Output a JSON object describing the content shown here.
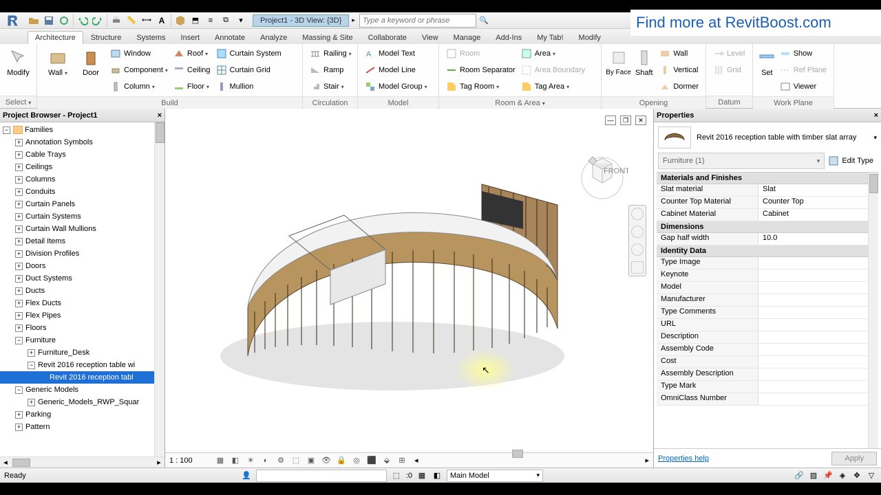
{
  "qat": {
    "title": "Project1 - 3D View: {3D}",
    "search_placeholder": "Type a keyword or phrase"
  },
  "boost_text": "Find more at RevitBoost.com",
  "tabs": [
    "Architecture",
    "Structure",
    "Systems",
    "Insert",
    "Annotate",
    "Analyze",
    "Massing & Site",
    "Collaborate",
    "View",
    "Manage",
    "Add-Ins",
    "My Tab!",
    "Modify"
  ],
  "active_tab": "Architecture",
  "ribbon": {
    "select": "Select",
    "modify": "Modify",
    "build": {
      "label": "Build",
      "wall": "Wall",
      "door": "Door",
      "window": "Window",
      "component": "Component",
      "column": "Column",
      "roof": "Roof",
      "ceiling": "Ceiling",
      "floor": "Floor",
      "curtain_system": "Curtain System",
      "curtain_grid": "Curtain Grid",
      "mullion": "Mullion"
    },
    "circulation": {
      "label": "Circulation",
      "railing": "Railing",
      "ramp": "Ramp",
      "stair": "Stair"
    },
    "model": {
      "label": "Model",
      "text": "Model Text",
      "line": "Model Line",
      "group": "Model Group"
    },
    "room_area": {
      "label": "Room & Area",
      "room": "Room",
      "sep": "Room Separator",
      "tag_room": "Tag Room",
      "area": "Area",
      "area_boundary": "Area Boundary",
      "tag_area": "Tag Area"
    },
    "opening": {
      "label": "Opening",
      "by_face": "By Face",
      "shaft": "Shaft",
      "wall": "Wall",
      "vertical": "Vertical",
      "dormer": "Dormer"
    },
    "datum": {
      "label": "Datum",
      "level": "Level",
      "grid": "Grid"
    },
    "work_plane": {
      "label": "Work Plane",
      "set": "Set",
      "show": "Show",
      "ref_plane": "Ref Plane",
      "viewer": "Viewer"
    }
  },
  "browser": {
    "title": "Project Browser - Project1",
    "root": "Families",
    "items": [
      "Annotation Symbols",
      "Cable Trays",
      "Ceilings",
      "Columns",
      "Conduits",
      "Curtain Panels",
      "Curtain Systems",
      "Curtain Wall Mullions",
      "Detail Items",
      "Division Profiles",
      "Doors",
      "Duct Systems",
      "Ducts",
      "Flex Ducts",
      "Flex Pipes",
      "Floors"
    ],
    "furniture": "Furniture",
    "furniture_desk": "Furniture_Desk",
    "reception_family": "Revit 2016 reception table wi",
    "reception_type": "Revit 2016 reception tabl",
    "tail": [
      "Generic Models",
      "Generic_Models_RWP_Squar",
      "Parking",
      "Pattern"
    ]
  },
  "viewport": {
    "scale": "1 : 100"
  },
  "properties": {
    "title": "Properties",
    "family": "Revit 2016 reception table with timber slat array",
    "selector": "Furniture (1)",
    "edit_type": "Edit Type",
    "groups": [
      {
        "name": "Materials and Finishes",
        "rows": [
          {
            "k": "Slat material",
            "v": "Slat"
          },
          {
            "k": "Counter Top Material",
            "v": "Counter Top"
          },
          {
            "k": "Cabinet Material",
            "v": "Cabinet"
          }
        ]
      },
      {
        "name": "Dimensions",
        "rows": [
          {
            "k": "Gap half width",
            "v": "10.0"
          }
        ]
      },
      {
        "name": "Identity Data",
        "rows": [
          {
            "k": "Type Image",
            "v": ""
          },
          {
            "k": "Keynote",
            "v": ""
          },
          {
            "k": "Model",
            "v": ""
          },
          {
            "k": "Manufacturer",
            "v": ""
          },
          {
            "k": "Type Comments",
            "v": ""
          },
          {
            "k": "URL",
            "v": ""
          },
          {
            "k": "Description",
            "v": ""
          },
          {
            "k": "Assembly Code",
            "v": ""
          },
          {
            "k": "Cost",
            "v": ""
          },
          {
            "k": "Assembly Description",
            "v": ""
          },
          {
            "k": "Type Mark",
            "v": ""
          },
          {
            "k": "OmniClass Number",
            "v": ""
          }
        ]
      }
    ],
    "help": "Properties help",
    "apply": "Apply"
  },
  "status": {
    "ready": "Ready",
    "count": ":0",
    "model": "Main Model"
  }
}
